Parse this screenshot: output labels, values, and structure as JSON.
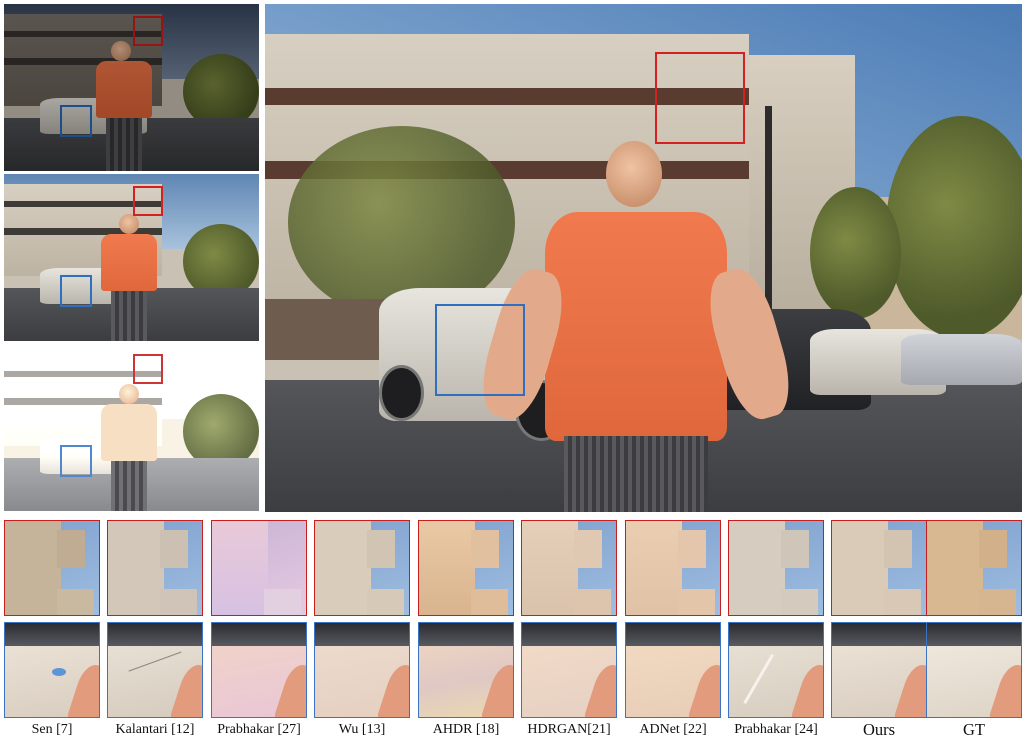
{
  "figure": {
    "crop_labels": [
      "Sen [7]",
      "Kalantari [12]",
      "Prabhakar [27]",
      "Wu [13]",
      "AHDR [18]",
      "HDRGAN[21]",
      "ADNet [22]",
      "Prabhakar [24]",
      "Ours",
      "GT"
    ],
    "colors": {
      "highlight_red": "#d42020",
      "highlight_blue": "#2e6fc2"
    }
  }
}
